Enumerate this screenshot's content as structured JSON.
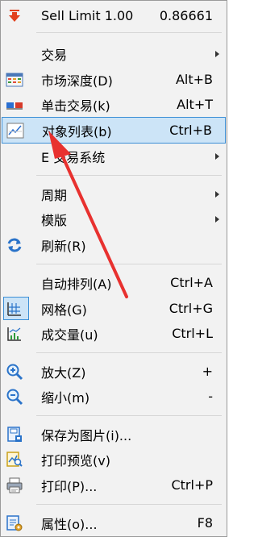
{
  "menu": {
    "sell_limit": {
      "label": "Sell Limit 1.00",
      "shortcut": "0.86661"
    },
    "trading": {
      "label": "交易"
    },
    "market_depth": {
      "label": "市场深度(D)",
      "shortcut": "Alt+B"
    },
    "one_click": {
      "label": "单击交易(k)",
      "shortcut": "Alt+T"
    },
    "object_list": {
      "label": "对象列表(b)",
      "shortcut": "Ctrl+B"
    },
    "trading_system": {
      "label": "E 交易系统"
    },
    "period": {
      "label": "周期"
    },
    "template": {
      "label": "模版"
    },
    "refresh": {
      "label": "刷新(R)"
    },
    "auto_arrange": {
      "label": "自动排列(A)",
      "shortcut": "Ctrl+A"
    },
    "grid": {
      "label": "网格(G)",
      "shortcut": "Ctrl+G"
    },
    "volume": {
      "label": "成交量(u)",
      "shortcut": "Ctrl+L"
    },
    "zoom_in": {
      "label": "放大(Z)",
      "shortcut": "+"
    },
    "zoom_out": {
      "label": "缩小(m)",
      "shortcut": "-"
    },
    "save_picture": {
      "label": "保存为图片(i)..."
    },
    "print_preview": {
      "label": "打印预览(v)"
    },
    "print": {
      "label": "打印(P)...",
      "shortcut": "Ctrl+P"
    },
    "properties": {
      "label": "属性(o)...",
      "shortcut": "F8"
    }
  },
  "colors": {
    "highlight": "#cce4f7",
    "highlight_border": "#3c8fd6",
    "annotation_arrow": "#e8312f"
  }
}
